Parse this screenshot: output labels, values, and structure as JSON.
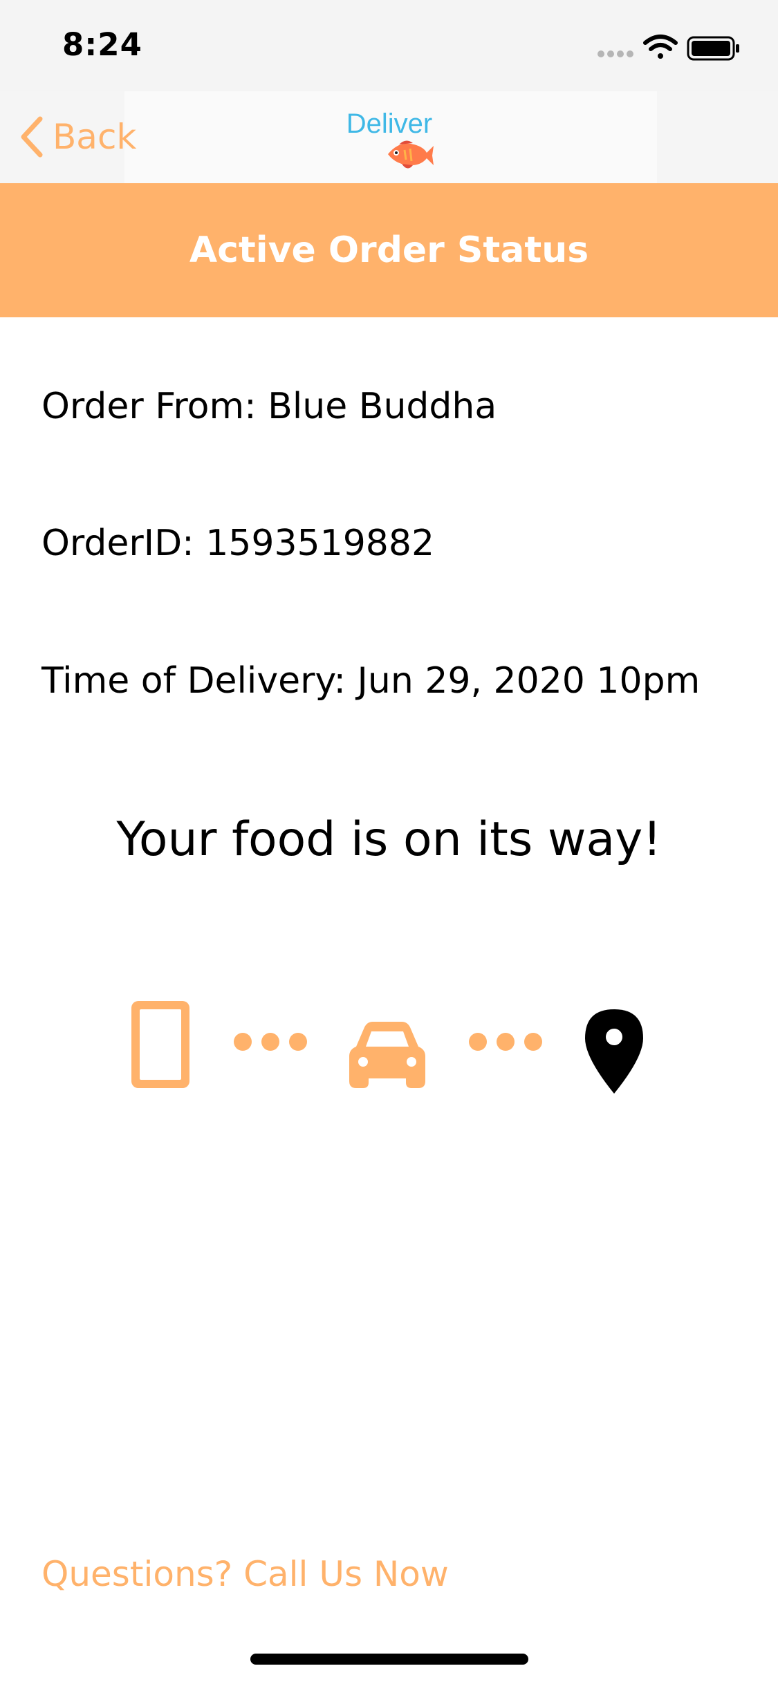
{
  "status_bar": {
    "time": "8:24"
  },
  "nav": {
    "back_label": "Back",
    "logo_text": "Deliver",
    "accent_color": "#ffb26b",
    "logo_color": "#3fb8e6"
  },
  "header": {
    "title": "Active Order Status"
  },
  "order": {
    "from": "Order From: Blue Buddha",
    "order_id": "OrderID: 1593519882",
    "delivery_time": "Time of Delivery: Jun 29, 2020 10pm"
  },
  "status": {
    "message": "Your food is on its way!",
    "steps": [
      {
        "icon": "phone-icon",
        "state": "complete"
      },
      {
        "icon": "car-icon",
        "state": "complete"
      },
      {
        "icon": "location-pin-icon",
        "state": "pending"
      }
    ]
  },
  "footer": {
    "call_link": "Questions? Call Us Now"
  }
}
